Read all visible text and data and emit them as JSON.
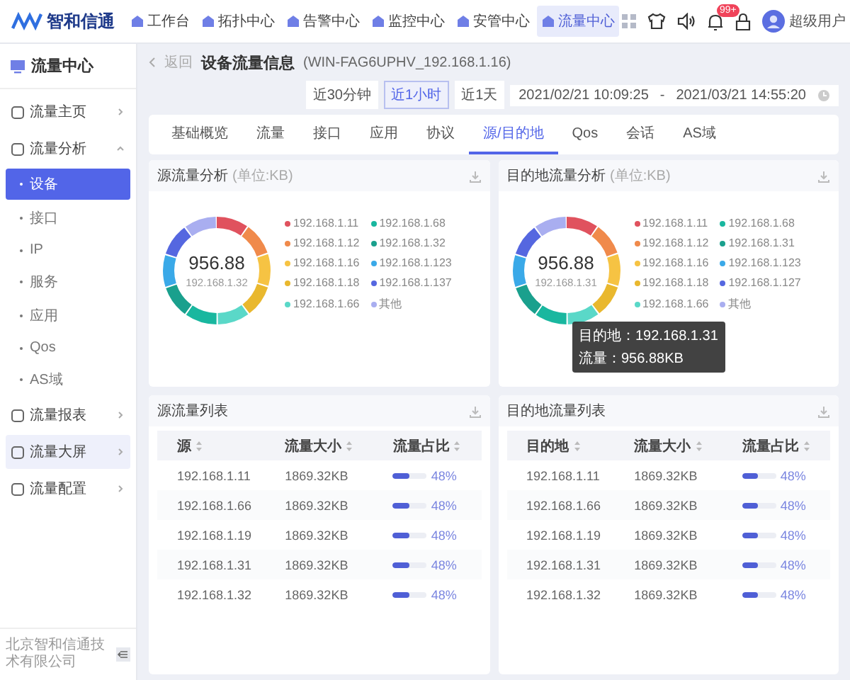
{
  "nav": {
    "logo": "智和信通",
    "items": [
      {
        "label": "工作台",
        "selected": false
      },
      {
        "label": "拓扑中心",
        "selected": false
      },
      {
        "label": "告警中心",
        "selected": false
      },
      {
        "label": "监控中心",
        "selected": false
      },
      {
        "label": "安管中心",
        "selected": false
      },
      {
        "label": "流量中心",
        "selected": true
      }
    ],
    "badge": "99+",
    "user": "超级用户"
  },
  "sidebar": {
    "title": "流量中心",
    "items": [
      {
        "label": "流量主页",
        "selected": false,
        "expanded": false
      },
      {
        "label": "流量分析",
        "selected": false,
        "expanded": true,
        "children": [
          {
            "label": "设备",
            "selected": true
          },
          {
            "label": "接口",
            "selected": false
          },
          {
            "label": "IP",
            "selected": false
          },
          {
            "label": "服务",
            "selected": false
          },
          {
            "label": "应用",
            "selected": false
          },
          {
            "label": "Qos",
            "selected": false
          },
          {
            "label": "AS域",
            "selected": false
          }
        ]
      },
      {
        "label": "流量报表",
        "selected": false,
        "expanded": false
      },
      {
        "label": "流量大屏",
        "selected": true,
        "expanded": false
      },
      {
        "label": "流量配置",
        "selected": false,
        "expanded": false
      }
    ],
    "footer": "北京智和信通技术有限公司"
  },
  "header": {
    "back": "返回",
    "title": "设备流量信息",
    "device": "(WIN-FAG6UPHV_192.168.1.16)",
    "ranges": [
      {
        "label": "近30分钟",
        "selected": false
      },
      {
        "label": "近1小时",
        "selected": true
      },
      {
        "label": "近1天",
        "selected": false
      }
    ],
    "start": "2021/02/21 10:09:25",
    "separator": "-",
    "end": "2021/03/21 14:55:20"
  },
  "tabs": [
    {
      "label": "基础概览",
      "selected": false
    },
    {
      "label": "流量",
      "selected": false
    },
    {
      "label": "接口",
      "selected": false
    },
    {
      "label": "应用",
      "selected": false
    },
    {
      "label": "协议",
      "selected": false
    },
    {
      "label": "源/目的地",
      "selected": true
    },
    {
      "label": "Qos",
      "selected": false
    },
    {
      "label": "会话",
      "selected": false
    },
    {
      "label": "AS域",
      "selected": false
    }
  ],
  "charts": [
    {
      "title": "源流量分析",
      "unit": "(单位:KB)",
      "value": "956.88",
      "caption": "192.168.1.32",
      "legend": [
        {
          "label": "192.168.1.11",
          "color": "#e0525e"
        },
        {
          "label": "192.168.1.12",
          "color": "#f08a4b"
        },
        {
          "label": "192.168.1.16",
          "color": "#f6c343"
        },
        {
          "label": "192.168.1.18",
          "color": "#e9b82e"
        },
        {
          "label": "192.168.1.66",
          "color": "#5ad8c8"
        },
        {
          "label": "192.168.1.68",
          "color": "#19b79f"
        },
        {
          "label": "192.168.1.32",
          "color": "#1aa08d"
        },
        {
          "label": "192.168.1.123",
          "color": "#3aa9e8"
        },
        {
          "label": "192.168.1.137",
          "color": "#5567e0"
        },
        {
          "label": "其他",
          "color": "#a9aef0"
        }
      ]
    },
    {
      "title": "目的地流量分析",
      "unit": "(单位:KB)",
      "value": "956.88",
      "caption": "192.168.1.31",
      "legend": [
        {
          "label": "192.168.1.11",
          "color": "#e0525e"
        },
        {
          "label": "192.168.1.12",
          "color": "#f08a4b"
        },
        {
          "label": "192.168.1.16",
          "color": "#f6c343"
        },
        {
          "label": "192.168.1.18",
          "color": "#e9b82e"
        },
        {
          "label": "192.168.1.66",
          "color": "#5ad8c8"
        },
        {
          "label": "192.168.1.68",
          "color": "#19b79f"
        },
        {
          "label": "192.168.1.31",
          "color": "#1aa08d"
        },
        {
          "label": "192.168.1.123",
          "color": "#3aa9e8"
        },
        {
          "label": "192.168.1.127",
          "color": "#5567e0"
        },
        {
          "label": "其他",
          "color": "#a9aef0"
        }
      ],
      "tooltip": [
        "目的地：192.168.1.31",
        "流量：956.88KB"
      ]
    }
  ],
  "tables": [
    {
      "title": "源流量列表",
      "columns": [
        "源",
        "流量大小",
        "流量占比"
      ],
      "rows": [
        {
          "host": "192.168.1.11",
          "size": "1869.32KB",
          "level": 0.48,
          "share": "48%"
        },
        {
          "host": "192.168.1.66",
          "size": "1869.32KB",
          "level": 0.48,
          "share": "48%"
        },
        {
          "host": "192.168.1.19",
          "size": "1869.32KB",
          "level": 0.48,
          "share": "48%"
        },
        {
          "host": "192.168.1.31",
          "size": "1869.32KB",
          "level": 0.48,
          "share": "48%"
        },
        {
          "host": "192.168.1.32",
          "size": "1869.32KB",
          "level": 0.48,
          "share": "48%"
        }
      ]
    },
    {
      "title": "目的地流量列表",
      "columns": [
        "目的地",
        "流量大小",
        "流量占比"
      ],
      "rows": [
        {
          "host": "192.168.1.11",
          "size": "1869.32KB",
          "level": 0.48,
          "share": "48%"
        },
        {
          "host": "192.168.1.66",
          "size": "1869.32KB",
          "level": 0.48,
          "share": "48%"
        },
        {
          "host": "192.168.1.19",
          "size": "1869.32KB",
          "level": 0.48,
          "share": "48%"
        },
        {
          "host": "192.168.1.31",
          "size": "1869.32KB",
          "level": 0.48,
          "share": "48%"
        },
        {
          "host": "192.168.1.32",
          "size": "1869.32KB",
          "level": 0.48,
          "share": "48%"
        }
      ]
    }
  ]
}
